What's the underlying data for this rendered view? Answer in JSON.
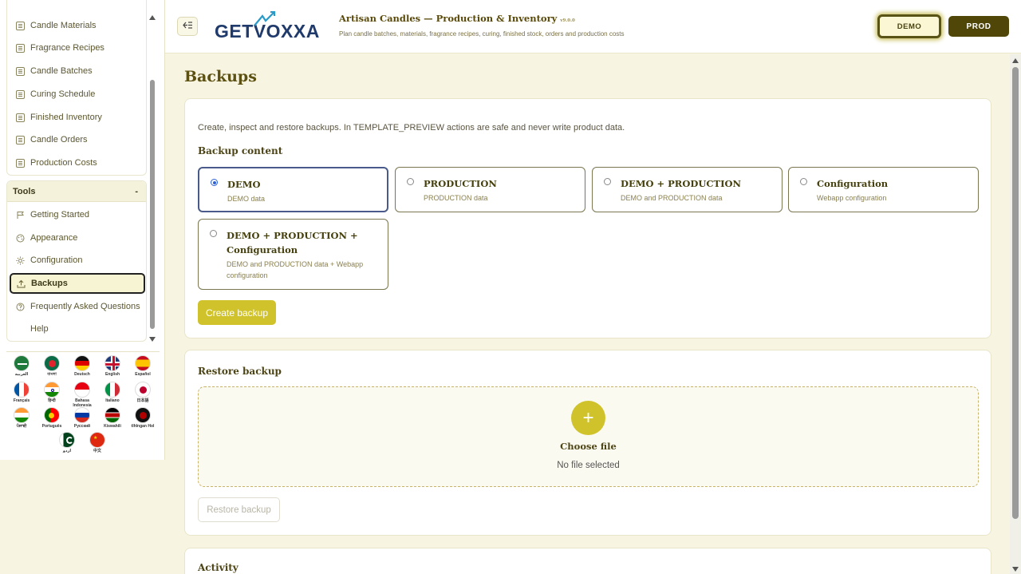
{
  "sidebar": {
    "items": [
      {
        "label": "Candle Materials",
        "icon": "list-icon"
      },
      {
        "label": "Fragrance Recipes",
        "icon": "list-icon"
      },
      {
        "label": "Candle Batches",
        "icon": "list-icon"
      },
      {
        "label": "Curing Schedule",
        "icon": "list-icon"
      },
      {
        "label": "Finished Inventory",
        "icon": "list-icon"
      },
      {
        "label": "Candle Orders",
        "icon": "list-icon"
      },
      {
        "label": "Production Costs",
        "icon": "list-icon"
      }
    ],
    "tools_title": "Tools",
    "tools_toggle": "-",
    "tools": [
      {
        "label": "Getting Started",
        "icon": "flag-icon"
      },
      {
        "label": "Appearance",
        "icon": "palette-icon"
      },
      {
        "label": "Configuration",
        "icon": "gear-icon"
      },
      {
        "label": "Backups",
        "icon": "upload-icon"
      },
      {
        "label": "Frequently Asked Questions",
        "icon": "question-icon"
      },
      {
        "label": "Help",
        "icon": ""
      }
    ]
  },
  "languages": [
    {
      "name": "العربية"
    },
    {
      "name": "বাংলা"
    },
    {
      "name": "Deutsch"
    },
    {
      "name": "English"
    },
    {
      "name": "Español"
    },
    {
      "name": "Français"
    },
    {
      "name": "हिन्दी"
    },
    {
      "name": "Bahasa Indonesia"
    },
    {
      "name": "Italiano"
    },
    {
      "name": "日本語"
    },
    {
      "name": "ਪੰਜਾਬੀ"
    },
    {
      "name": "Português"
    },
    {
      "name": "Русский"
    },
    {
      "name": "Kiswahili"
    },
    {
      "name": "tlhIngan Hol"
    },
    {
      "name": "اردو"
    },
    {
      "name": "中文"
    }
  ],
  "header": {
    "logo": "GETVOXXA",
    "title": "Artisan Candles — Production & Inventory",
    "version": "v9.0.0",
    "subtitle": "Plan candle batches, materials, fragrance recipes, curing, finished stock, orders and production costs",
    "env_demo": "DEMO",
    "env_prod": "PROD"
  },
  "page": {
    "title": "Backups",
    "intro": "Create, inspect and restore backups. In TEMPLATE_PREVIEW actions are safe and never write product data.",
    "backup_content_heading": "Backup content",
    "options": [
      {
        "title": "DEMO",
        "desc": "DEMO data",
        "selected": true
      },
      {
        "title": "PRODUCTION",
        "desc": "PRODUCTION data",
        "selected": false
      },
      {
        "title": "DEMO + PRODUCTION",
        "desc": "DEMO and PRODUCTION data",
        "selected": false
      },
      {
        "title": "Configuration",
        "desc": "Webapp configuration",
        "selected": false
      },
      {
        "title": "DEMO + PRODUCTION + Configuration",
        "desc": "DEMO and PRODUCTION data + Webapp configuration",
        "selected": false
      }
    ],
    "create_button": "Create backup",
    "restore_heading": "Restore backup",
    "plus": "+",
    "choose_file": "Choose file",
    "no_file": "No file selected",
    "restore_button": "Restore backup",
    "activity_heading": "Activity"
  }
}
